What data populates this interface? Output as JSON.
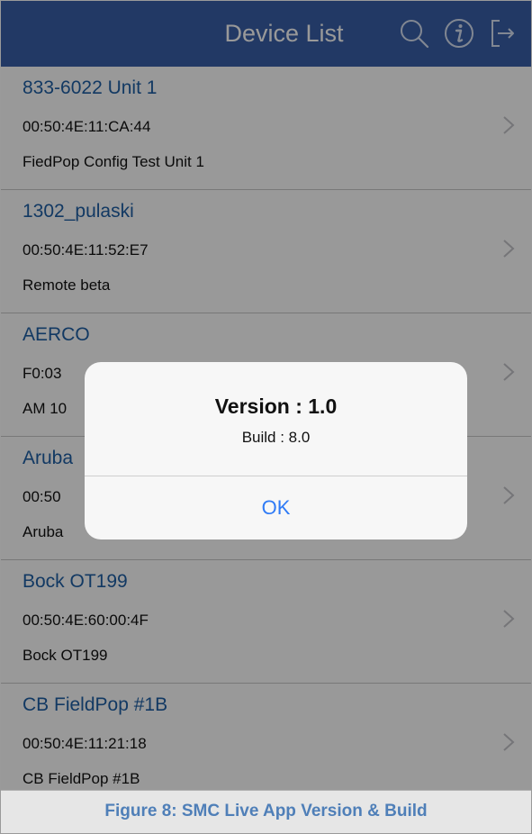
{
  "header": {
    "title": "Device List",
    "icons": [
      "search-icon",
      "info-icon",
      "logout-icon"
    ],
    "background_color": "#3a5fa8"
  },
  "devices": [
    {
      "name": "833-6022 Unit 1",
      "mac": "00:50:4E:11:CA:44",
      "description": "FiedPop Config Test Unit 1"
    },
    {
      "name": "1302_pulaski",
      "mac": "00:50:4E:11:52:E7",
      "description": "Remote beta"
    },
    {
      "name": "AERCO",
      "mac": "F0:03",
      "description": "AM 10"
    },
    {
      "name": "Aruba",
      "mac": "00:50",
      "description": "Aruba"
    },
    {
      "name": "Bock OT199",
      "mac": "00:50:4E:60:00:4F",
      "description": "Bock OT199"
    },
    {
      "name": "CB FieldPop #1B",
      "mac": "00:50:4E:11:21:18",
      "description": "CB FieldPop #1B"
    }
  ],
  "alert": {
    "title": "Version : 1.0",
    "subtitle": "Build : 8.0",
    "ok_label": "OK",
    "ok_color": "#2f7bf6"
  },
  "caption": {
    "text": "Figure 8: SMC Live App Version & Build",
    "color": "#4f7fb8"
  }
}
